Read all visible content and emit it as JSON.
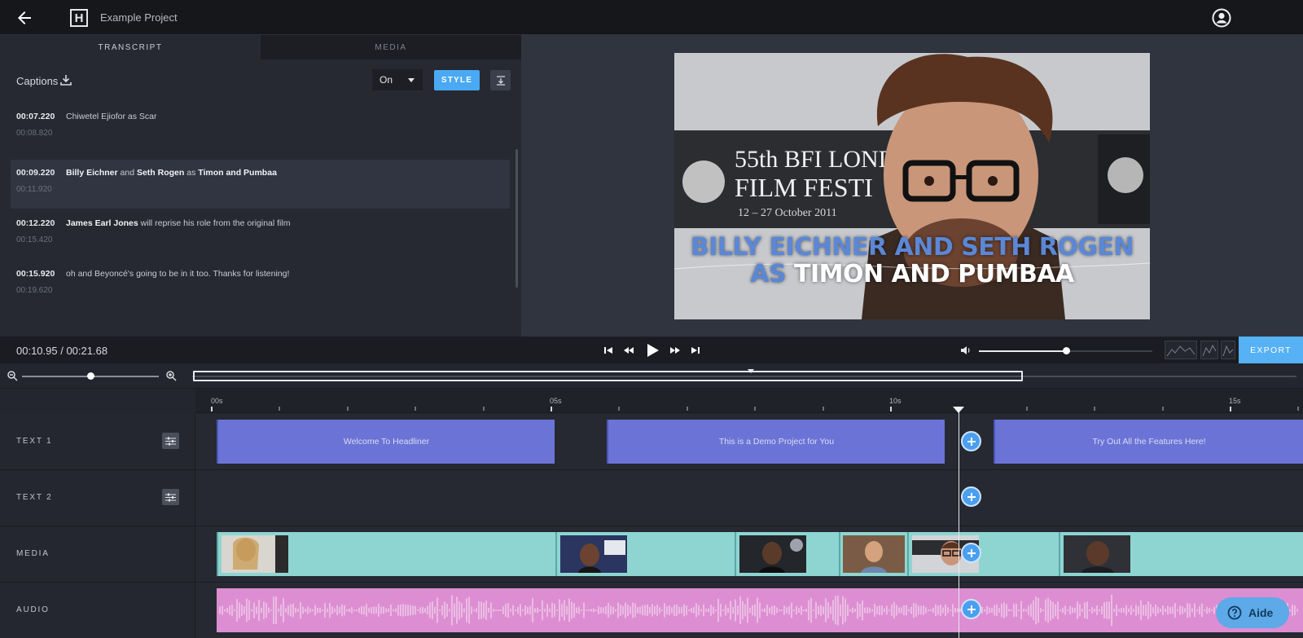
{
  "header": {
    "logo_letter": "H",
    "project_title": "Example Project"
  },
  "left_panel": {
    "tabs": [
      {
        "label": "TRANSCRIPT",
        "active": true
      },
      {
        "label": "MEDIA",
        "active": false
      }
    ],
    "captions_label": "Captions",
    "captions_select_value": "On",
    "style_label": "STYLE",
    "captions": [
      {
        "start": "00:07.220",
        "end": "00:08.820",
        "text": "Chiwetel Ejiofor as Scar"
      },
      {
        "start": "00:09.220",
        "end": "00:11.920",
        "text_parts": [
          {
            "text": "Billy Eichner",
            "bold": true
          },
          {
            "text": " and ",
            "bold": false
          },
          {
            "text": "Seth Rogen",
            "bold": true
          },
          {
            "text": " as ",
            "bold": false
          },
          {
            "text": "Timon and Pumbaa",
            "bold": true
          }
        ]
      },
      {
        "start": "00:12.220",
        "end": "00:15.420",
        "text_parts": [
          {
            "text": "James Earl Jones",
            "bold": true
          },
          {
            "text": " will reprise his role from the original film",
            "bold": false
          }
        ]
      },
      {
        "start": "00:15.920",
        "end": "00:19.620",
        "text": "oh and Beyoncé's going to be in it too. Thanks for listening!"
      }
    ]
  },
  "preview": {
    "caption_highlight": "BILLY EICHNER AND SETH ROGEN AS",
    "caption_rest": "TIMON AND PUMBAA",
    "sign_line1": "55th BFI LONDON",
    "sign_line2": "FILM FESTI",
    "sign_line3": "12 – 27 October 2011"
  },
  "transport": {
    "timecode": "00:10.95 / 00:21.68",
    "volume_level": 0.5,
    "export_label": "EXPORT"
  },
  "timeline": {
    "zoom_level": 0.5,
    "ruler_labels": [
      "00s",
      "05s",
      "10s",
      "15s"
    ],
    "playhead_time": "00:10.95",
    "tracks": [
      {
        "label": "TEXT 1",
        "clips": [
          "Welcome To Headliner",
          "This is a Demo Project for You",
          "Try Out All the Features Here!"
        ]
      },
      {
        "label": "TEXT 2",
        "clips": []
      },
      {
        "label": "MEDIA"
      },
      {
        "label": "AUDIO"
      }
    ]
  },
  "help": {
    "label": "Aide"
  },
  "colors": {
    "accent": "#4aa9f2",
    "text_clip": "#6b74d6",
    "media_clip": "#8ed5d2",
    "audio_clip": "#dd8ed2"
  }
}
